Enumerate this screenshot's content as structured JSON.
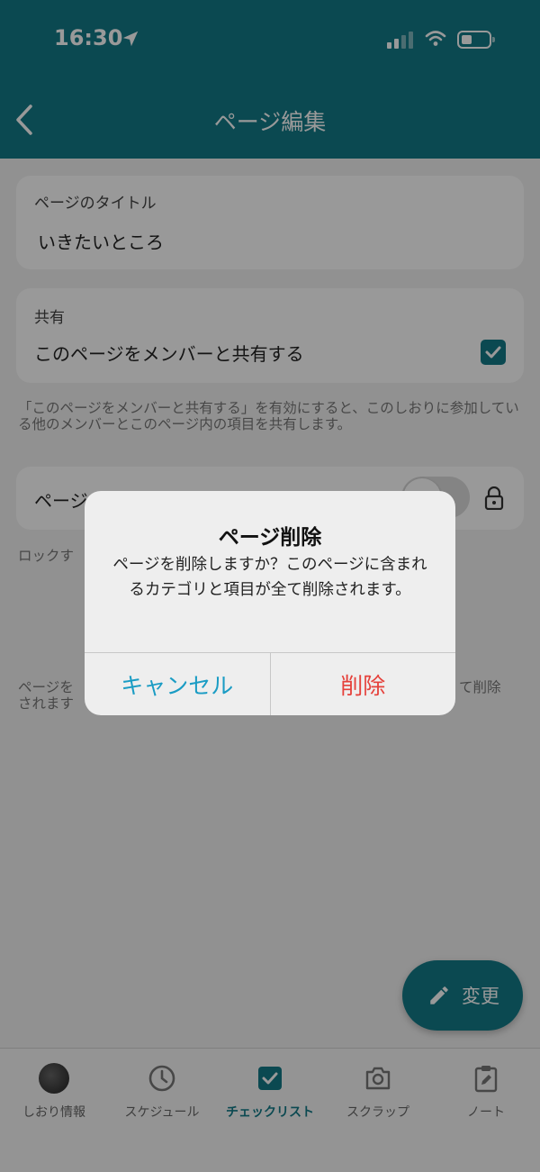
{
  "status_bar": {
    "time": "16:30"
  },
  "header": {
    "title": "ページ編集"
  },
  "title_card": {
    "label": "ページのタイトル",
    "value": "いきたいところ"
  },
  "share_card": {
    "label": "共有",
    "option": "このページをメンバーと共有する",
    "checked": true
  },
  "share_help": "「このページをメンバーと共有する」を有効にすると、このしおりに参加している他のメンバーとこのページ内の項目を共有します。",
  "lock_card": {
    "label_partial": "ページ",
    "enabled": false
  },
  "lock_help_partial": "ロックす",
  "delete_help": {
    "left_partial": "ページを",
    "right_partial": "て削除",
    "second_line_partial": "されます"
  },
  "fab": {
    "label": "変更"
  },
  "tabs": [
    {
      "label": "しおり情報",
      "icon": "avatar-icon",
      "active": false
    },
    {
      "label": "スケジュール",
      "icon": "clock-icon",
      "active": false
    },
    {
      "label": "チェックリスト",
      "icon": "checkbox-icon",
      "active": true
    },
    {
      "label": "スクラップ",
      "icon": "camera-icon",
      "active": false
    },
    {
      "label": "ノート",
      "icon": "clipboard-edit-icon",
      "active": false
    }
  ],
  "dialog": {
    "title": "ページ削除",
    "message": "ページを削除しますか？このページに含まれるカテゴリと項目が全て削除されます。",
    "cancel_label": "キャンセル",
    "delete_label": "削除"
  },
  "colors": {
    "accent": "#137b88",
    "cancel": "#1a9cc4",
    "destructive": "#e5413b"
  }
}
